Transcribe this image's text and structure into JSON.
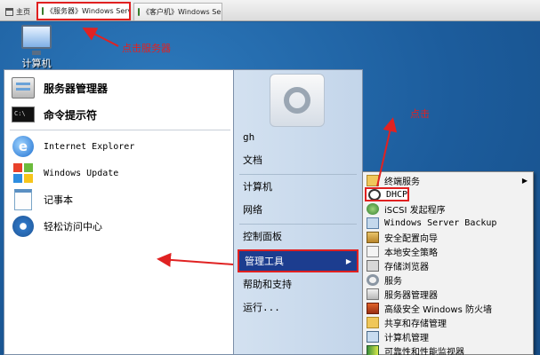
{
  "tabs": [
    {
      "label": "主页"
    },
    {
      "label": "《服务器》Windows Serv...",
      "close": "×"
    },
    {
      "label": "《客户机》Windows Server ...",
      "close": "×"
    }
  ],
  "desktop": {
    "icon_label": "计算机"
  },
  "annotations": {
    "click_server": "点击服务器",
    "click_left": "点击",
    "click_top": "点击"
  },
  "start_left": {
    "items": [
      {
        "label": "服务器管理器",
        "icon": "server-manager-icon"
      },
      {
        "label": "命令提示符",
        "icon": "command-prompt-icon"
      },
      {
        "label": "Internet Explorer",
        "icon": "internet-explorer-icon"
      },
      {
        "label": "Windows Update",
        "icon": "windows-update-icon"
      },
      {
        "label": "记事本",
        "icon": "notepad-icon"
      },
      {
        "label": "轻松访问中心",
        "icon": "ease-of-access-icon"
      }
    ]
  },
  "start_right": {
    "items": [
      {
        "label": "gh"
      },
      {
        "label": "文档"
      },
      {
        "label": "计算机"
      },
      {
        "label": "网络"
      },
      {
        "label": "控制面板"
      },
      {
        "label": "管理工具",
        "arrow": "▶"
      },
      {
        "label": "帮助和支持"
      },
      {
        "label": "运行..."
      }
    ]
  },
  "admin_tools": {
    "items": [
      {
        "label": "终端服务",
        "arrow": "▶"
      },
      {
        "label": "DHCP"
      },
      {
        "label": "iSCSI 发起程序"
      },
      {
        "label": "Windows Server Backup"
      },
      {
        "label": "安全配置向导"
      },
      {
        "label": "本地安全策略"
      },
      {
        "label": "存储浏览器"
      },
      {
        "label": "服务"
      },
      {
        "label": "服务器管理器"
      },
      {
        "label": "高级安全 Windows 防火墙"
      },
      {
        "label": "共享和存储管理"
      },
      {
        "label": "计算机管理"
      },
      {
        "label": "可靠性和性能监视器"
      }
    ]
  },
  "colors": {
    "annotation": "#e02222",
    "highlight": "#1c3d8f",
    "desktop": "#1e5d99"
  }
}
